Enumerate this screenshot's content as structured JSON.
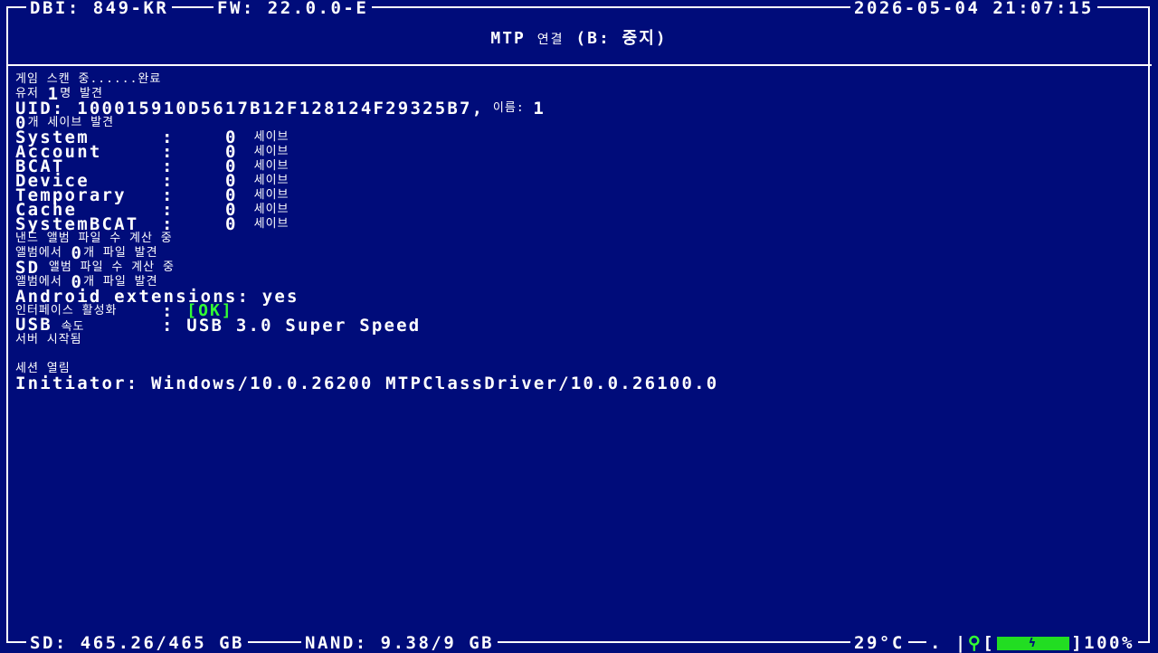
{
  "header": {
    "dbi": "DBI: 849-KR",
    "fw": "FW: 22.0.0-E",
    "datetime": "2026-05-04 21:07:15",
    "title_prefix": "MTP",
    "title_suffix": "연결",
    "title_hint": "(B: 중지)"
  },
  "log": {
    "scan": "게임 스캔 중......완료",
    "users_prefix": "유저",
    "users_count": "1",
    "users_suffix": "명 발견",
    "uid_text": "UID: 100015910D5617B12F128124F29325B7,",
    "uid_name_label": "이름:",
    "uid_name_value": "1",
    "saves_found_count": "0",
    "saves_found_suffix": "개 세이브 발견",
    "save_rows": [
      {
        "name": "System",
        "count": "0",
        "unit": "세이브"
      },
      {
        "name": "Account",
        "count": "0",
        "unit": "세이브"
      },
      {
        "name": "BCAT",
        "count": "0",
        "unit": "세이브"
      },
      {
        "name": "Device",
        "count": "0",
        "unit": "세이브"
      },
      {
        "name": "Temporary",
        "count": "0",
        "unit": "세이브"
      },
      {
        "name": "Cache",
        "count": "0",
        "unit": "세이브"
      },
      {
        "name": "SystemBCAT",
        "count": "0",
        "unit": "세이브"
      }
    ],
    "nand_album_calc": "낸드 앨범 파일 수 계산 중",
    "nand_album_found_prefix": "앨범에서",
    "nand_album_found_count": "0",
    "nand_album_found_suffix": "개 파일 발견",
    "sd_prefix": "SD",
    "sd_album_calc": "앨범 파일 수 계산 중",
    "sd_album_found_prefix": "앨범에서",
    "sd_album_found_count": "0",
    "sd_album_found_suffix": "개 파일 발견",
    "android_ext": "Android extensions: yes",
    "interface_label": "인터페이스 활성화",
    "interface_value": "[OK]",
    "usb_label_prefix": "USB",
    "usb_label_suffix": "속도",
    "usb_value": "USB 3.0 Super Speed",
    "server_started": "서버 시작됨",
    "session_open": "세션 열림",
    "initiator": "Initiator: Windows/10.0.26200 MTPClassDriver/10.0.26100.0"
  },
  "footer": {
    "sd": "SD: 465.26/465 GB",
    "nand": "NAND: 9.38/9 GB",
    "temp": "29°C",
    "battery": "100%",
    "colors": {
      "accent_green": "#33ff33",
      "background": "#000c7a"
    }
  }
}
